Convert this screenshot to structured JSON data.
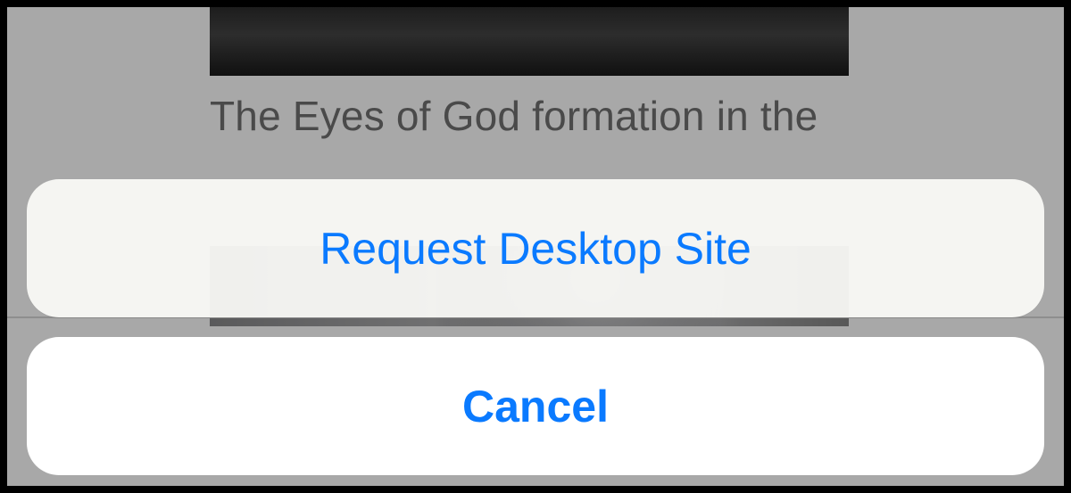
{
  "background": {
    "caption_line": "The Eyes of God formation in the"
  },
  "action_sheet": {
    "primary_label": "Request Desktop Site",
    "cancel_label": "Cancel"
  },
  "colors": {
    "ios_blue": "#0a7aff"
  }
}
